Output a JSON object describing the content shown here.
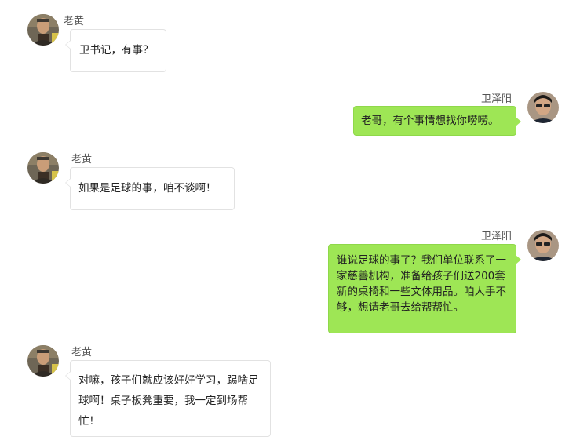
{
  "chat": {
    "messages": [
      {
        "sender": "老黄",
        "side": "left",
        "text": "卫书记，有事？"
      },
      {
        "sender": "卫泽阳",
        "side": "right",
        "text": "老哥，有个事情想找你唠唠。"
      },
      {
        "sender": "老黄",
        "side": "left",
        "text": "如果是足球的事，咱不谈啊！"
      },
      {
        "sender": "卫泽阳",
        "side": "right",
        "text": "谁说足球的事了？我们单位联系了一家慈善机构，准备给孩子们送200套新的桌椅和一些文体用品。咱人手不够，想请老哥去给帮帮忙。"
      },
      {
        "sender": "老黄",
        "side": "left",
        "text": "对嘛，孩子们就应该好好学习，踢啥足球啊！桌子板凳重要，我一定到场帮忙！"
      }
    ]
  },
  "colors": {
    "right_bubble": "#9ee655",
    "left_bubble": "#ffffff"
  },
  "icons": {
    "left_avatar": "avatar-old-man-icon",
    "right_avatar": "avatar-young-man-icon"
  }
}
